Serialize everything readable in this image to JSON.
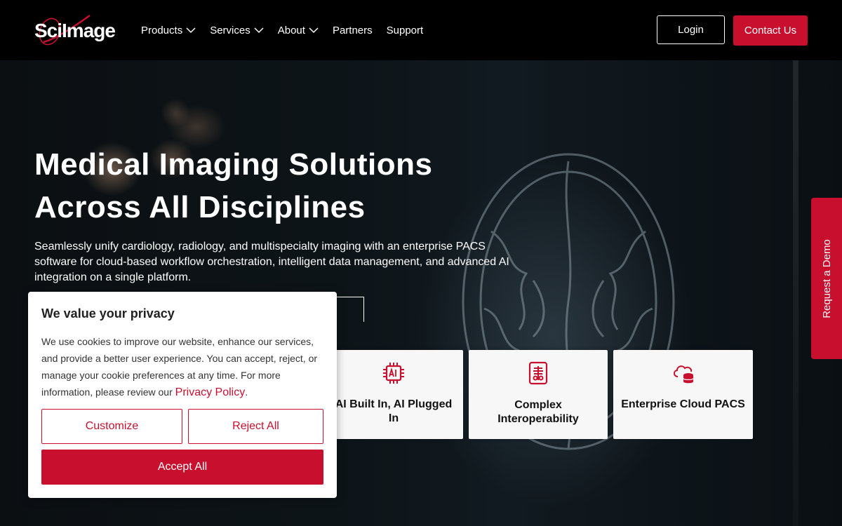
{
  "header": {
    "logo_text": "SciImage",
    "nav": [
      {
        "label": "Products",
        "has_dropdown": true
      },
      {
        "label": "Services",
        "has_dropdown": true
      },
      {
        "label": "About",
        "has_dropdown": true
      },
      {
        "label": "Partners",
        "has_dropdown": false
      },
      {
        "label": "Support",
        "has_dropdown": false
      }
    ],
    "login_label": "Login",
    "contact_label": "Contact Us"
  },
  "hero": {
    "title_line1": "Medical Imaging Solutions",
    "title_line2": "Across All Disciplines",
    "subtitle": "Seamlessly unify cardiology, radiology, and multispecialty imaging with an enterprise PACS software for cloud-based workflow orchestration, intelligent data management, and advanced AI integration on a single platform."
  },
  "cards": [
    {
      "label": "AI Built In, AI Plugged In",
      "icon": "ai-chip-icon"
    },
    {
      "label": "Complex Interoperability",
      "icon": "interoperability-icon"
    },
    {
      "label": "Enterprise Cloud PACS",
      "icon": "cloud-database-icon"
    }
  ],
  "side_tab": {
    "label": "Request a Demo"
  },
  "cookie": {
    "title": "We value your privacy",
    "body": "We use cookies to improve our website, enhance our services, and provide a better user experience. You can accept, reject, or manage your cookie preferences at any time. For more information, please review our ",
    "link_label": "Privacy Policy",
    "body_end": ".",
    "customize_label": "Customize",
    "reject_label": "Reject All",
    "accept_label": "Accept All"
  },
  "colors": {
    "brand_red": "#c8102e",
    "header_bg": "#000000",
    "card_bg": "#f7f7f7"
  }
}
